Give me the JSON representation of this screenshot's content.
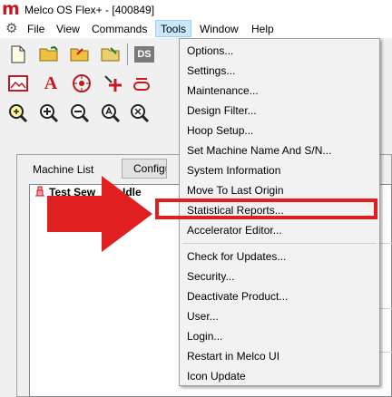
{
  "app": {
    "title": "Melco OS Flex+ - [400849]",
    "logo_text": "m"
  },
  "menubar": {
    "items": [
      "File",
      "View",
      "Commands",
      "Tools",
      "Window",
      "Help"
    ]
  },
  "toolbar": {
    "ds_label": "DS"
  },
  "panel": {
    "machine_list_label": "Machine List",
    "config_button": "Configure",
    "row_name": "Test Sew",
    "row_status": "Idle"
  },
  "tools_menu": {
    "group1": [
      "Options...",
      "Settings...",
      "Maintenance...",
      "Design Filter...",
      "Hoop Setup...",
      "Set Machine Name And  S/N...",
      "System Information",
      "Move To Last Origin",
      "Statistical Reports...",
      "Accelerator Editor..."
    ],
    "group2": [
      "Check for Updates...",
      "Security...",
      "Deactivate Product...",
      "User...",
      "Login...",
      "Restart in Melco UI",
      "Icon Update"
    ]
  },
  "annotation": {
    "highlighted_item": "Statistical Reports...",
    "arrow_color": "#e02020",
    "box_color": "#e02020"
  },
  "colors": {
    "brand": "#c8161d",
    "menu_open_bg": "#cce8ff"
  }
}
